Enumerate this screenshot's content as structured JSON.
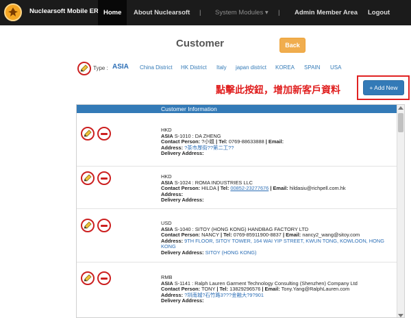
{
  "nav": {
    "brand": "Nuclearsoft Mobile ERP",
    "home": "Home",
    "about": "About Nuclearsoft",
    "sep": "|",
    "modules": "System Modules ▾",
    "admin": "Admin Member Area",
    "logout": "Logout"
  },
  "page": {
    "title": "Customer",
    "back_label": "Back"
  },
  "type_row": {
    "label": "Type :",
    "selected": "ASIA",
    "regions": [
      "China District",
      "HK District",
      "Italy",
      "japan district",
      "KOREA",
      "SPAIN",
      "USA"
    ]
  },
  "annotation": "點擊此按鈕，增加新客戶資料",
  "add_new_label": "+ Add New",
  "table": {
    "header": "Customer Information",
    "rows": [
      {
        "currency": "HKD",
        "region": "ASIA",
        "code_name": "S-1010 : DA ZHENG",
        "contact_label": "Contact Person:",
        "contact": "?小姐",
        "tel_label": "| Tel:",
        "tel": "0769-88633888",
        "email_label": "| Email:",
        "email": "",
        "address_label": "Address:",
        "address": "?茶市厚街??第二工??",
        "delivery_label": "Delivery Address:",
        "delivery": ""
      },
      {
        "currency": "HKD",
        "region": "ASIA",
        "code_name": "S-1024 : ROMA INDUSTRIES LLC",
        "contact_label": "Contact Person:",
        "contact": "HILDA",
        "tel_label": "| Tel:",
        "tel": "00852-23277676",
        "email_label": "| Email:",
        "email": "hildasiu@richpell.com.hk",
        "address_label": "Address:",
        "address": "",
        "delivery_label": "Delivery Address:",
        "delivery": ""
      },
      {
        "currency": "USD",
        "region": "ASIA",
        "code_name": "S-1040 : SITOY (HONG KONG) HANDBAG FACTORY LTD",
        "contact_label": "Contact Person:",
        "contact": "NANCY",
        "tel_label": "| Tel:",
        "tel": "0769-85911900-8837",
        "email_label": "| Email:",
        "email": "nancy2_wang@sitoy.com",
        "address_label": "Address:",
        "address": "9TH FLOOR, SITOY TOWER, 164 WAI YIP STREET, KWUN TONG, KOWLOON, HONG KONG",
        "delivery_label": "Delivery Address:",
        "delivery": "SITOY (HONG KONG)"
      },
      {
        "currency": "RMB",
        "region": "ASIA",
        "code_name": "S-1141 : Ralph Lauren Garment Technology Consulting (Shenzhen) Company Ltd",
        "contact_label": "Contact Person:",
        "contact": "TONY",
        "tel_label": "| Tel:",
        "tel": "13829296576",
        "email_label": "| Email:",
        "email": "Tony.Yang@RalphLauren.com",
        "address_label": "Address:",
        "address": "?圳南城?石竹路3???金融大?9?901",
        "delivery_label": "Delivery Address:",
        "delivery": ""
      }
    ]
  },
  "colors": {
    "navbar": "#1b1b1b",
    "primary": "#337ab7",
    "warning": "#f0ad4e",
    "annotation": "#e02020"
  }
}
